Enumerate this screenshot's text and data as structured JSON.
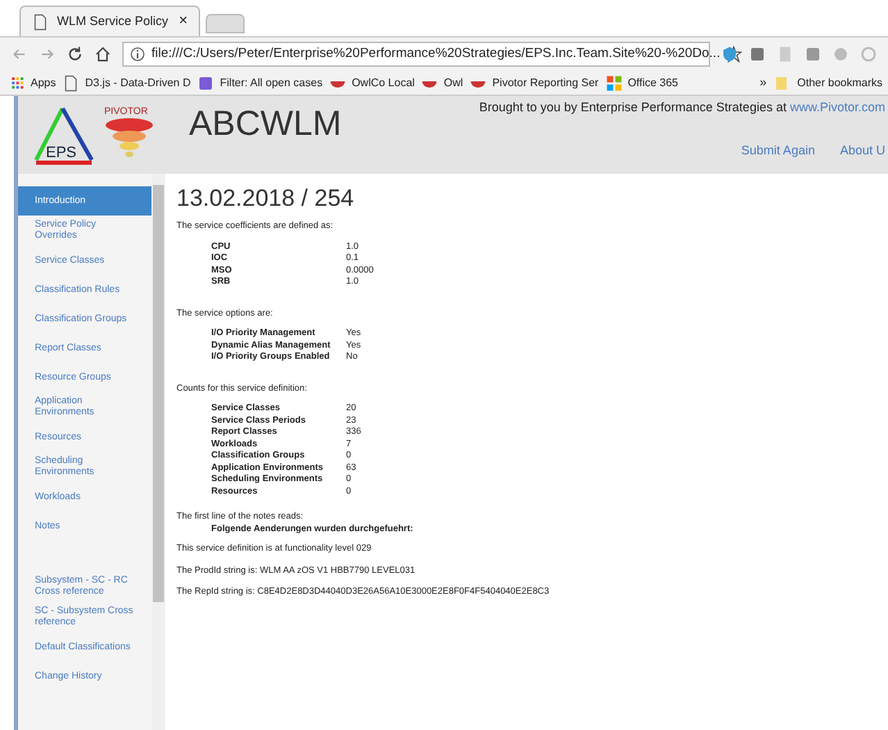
{
  "browser": {
    "tab_title": "WLM Service Policy",
    "tab_close": "×",
    "url": "file:///C:/Users/Peter/Enterprise%20Performance%20Strategies/EPS.Inc.Team.Site%20-%20Do...",
    "bookmarks": [
      "Apps",
      "D3.js - Data-Driven D",
      "Filter: All open cases",
      "OwlCo Local",
      "Owl",
      "Pivotor Reporting Ser",
      "Office 365"
    ],
    "more": "»",
    "other_bookmarks": "Other bookmarks"
  },
  "header": {
    "logo_text": "EPS",
    "logo_brand": "PIVOTOR",
    "title": "ABCWLM",
    "credit": "Brought to you by Enterprise Performance Strategies at ",
    "credit_link": "www.Pivotor.com",
    "links": [
      "Submit Again",
      "About U"
    ]
  },
  "sidebar": {
    "groups": [
      {
        "items": [
          {
            "label": "Introduction",
            "selected": true
          },
          {
            "label": "Service Policy Overrides",
            "selected": false
          },
          {
            "label": "Service Classes",
            "selected": false
          },
          {
            "label": "Classification Rules",
            "selected": false
          },
          {
            "label": "Classification Groups",
            "selected": false
          },
          {
            "label": "Report Classes",
            "selected": false
          },
          {
            "label": "Resource Groups",
            "selected": false
          },
          {
            "label": "Application Environments",
            "selected": false
          },
          {
            "label": "Resources",
            "selected": false
          },
          {
            "label": "Scheduling Environments",
            "selected": false
          },
          {
            "label": "Workloads",
            "selected": false
          },
          {
            "label": "Notes",
            "selected": false
          }
        ]
      },
      {
        "items": [
          {
            "label": "Subsystem - SC - RC Cross reference",
            "selected": false
          },
          {
            "label": "SC - Subsystem Cross reference",
            "selected": false
          },
          {
            "label": "Default Classifications",
            "selected": false
          },
          {
            "label": "Change History",
            "selected": false
          }
        ]
      }
    ]
  },
  "content": {
    "heading": "13.02.2018 / 254",
    "sections": [
      {
        "intro": "The service coefficients are defined as:",
        "rows": [
          [
            "CPU",
            "1.0"
          ],
          [
            "IOC",
            "0.1"
          ],
          [
            "MSO",
            "0.0000"
          ],
          [
            "SRB",
            "1.0"
          ]
        ]
      },
      {
        "intro": "The service options are:",
        "rows": [
          [
            "I/O Priority Management",
            "Yes"
          ],
          [
            "Dynamic Alias Management",
            "Yes"
          ],
          [
            "I/O Priority Groups Enabled",
            "No"
          ]
        ]
      },
      {
        "intro": "Counts for this service definition:",
        "rows": [
          [
            "Service Classes",
            "20"
          ],
          [
            "Service Class Periods",
            "23"
          ],
          [
            "Report Classes",
            "336"
          ],
          [
            "Workloads",
            "7"
          ],
          [
            "Classification Groups",
            "0"
          ],
          [
            "Application Environments",
            "63"
          ],
          [
            "Scheduling Environments",
            "0"
          ],
          [
            "Resources",
            "0"
          ]
        ]
      }
    ],
    "notes_intro": "The first line of the notes reads:",
    "notes_line": "Folgende Aenderungen wurden durchgefuehrt:",
    "lines": [
      "This service definition is at functionality level 029",
      "The ProdId string is: WLM AA zOS V1 HBB7790 LEVEL031",
      "The RepId string is: C8E4D2E8D3D44040D3E26A56A10E3000E2E8F0F4F5404040E2E8C3"
    ]
  }
}
